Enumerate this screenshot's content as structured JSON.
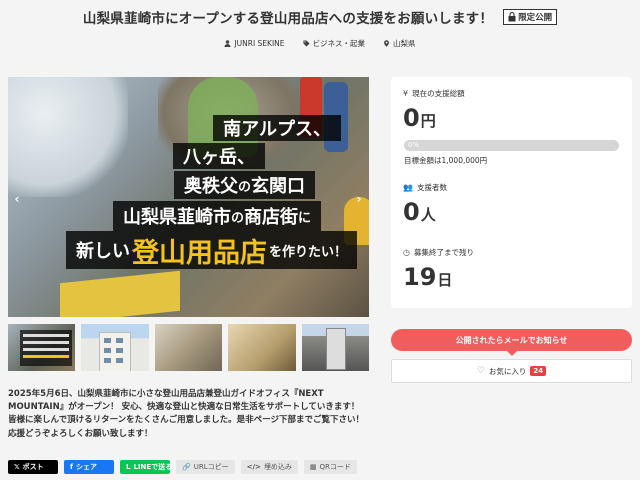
{
  "header": {
    "title": "山梨県韮崎市にオープンする登山用品店への支援をお願いします！",
    "limited_badge": "限定公開",
    "author": "JUNRI SEKINE",
    "category": "ビジネス・起業",
    "location": "山梨県"
  },
  "hero": {
    "line1": "南アルプス、",
    "line2": "八ヶ岳、",
    "line3_a": "奥秩父",
    "line3_b": "の",
    "line3_c": "玄関口",
    "line4_a": "山梨県韮崎市",
    "line4_b": "の",
    "line4_c": "商店街",
    "line4_d": "に",
    "line5_a": "新しい",
    "line5_b": "登山用品店",
    "line5_c": "を作りたい！",
    "arrow_left": "‹",
    "arrow_right": "›"
  },
  "description": "2025年5月6日、山梨県韮崎市に小さな登山用品店兼登山ガイドオフィス『NEXT MOUNTAIN』がオープン！ 安心、快適な登山と快適な日常生活をサポートしていきます！ 皆様に楽しんで頂けるリターンをたくさんご用意しました。是非ページ下部までご覧下さい！ 応援どうぞよろしくお願い致します！",
  "share": {
    "x": "ポスト",
    "facebook": "シェア",
    "line": "LINEで送る",
    "url_copy": "URLコピー",
    "embed": "埋め込み",
    "qr": "QRコード",
    "x_icon": "𝕏",
    "fb_icon": "f",
    "line_icon": "L",
    "link_icon": "🔗",
    "code_icon": "</>",
    "qr_icon": "▦"
  },
  "stats": {
    "current_label": "現在の支援総額",
    "current_value": "0",
    "current_unit": "円",
    "progress_percent": 0,
    "progress_label": "0%",
    "goal_text": "目標金額は1,000,000円",
    "supporters_label": "支援者数",
    "supporters_value": "0",
    "supporters_unit": "人",
    "remaining_label": "募集終了まで残り",
    "remaining_value": "19",
    "remaining_unit": "日",
    "yen_icon": "¥",
    "people_icon": "👥",
    "clock_icon": "◷"
  },
  "actions": {
    "notify_label": "公開されたらメールでお知らせ",
    "favorite_label": "お気に入り",
    "favorite_count": "24",
    "heart_icon": "♡"
  },
  "colors": {
    "accent_red": "#f15d5d",
    "progress_blue": "#2f9bd6",
    "badge_red": "#e84040",
    "hero_yellow": "#f4c21e"
  }
}
